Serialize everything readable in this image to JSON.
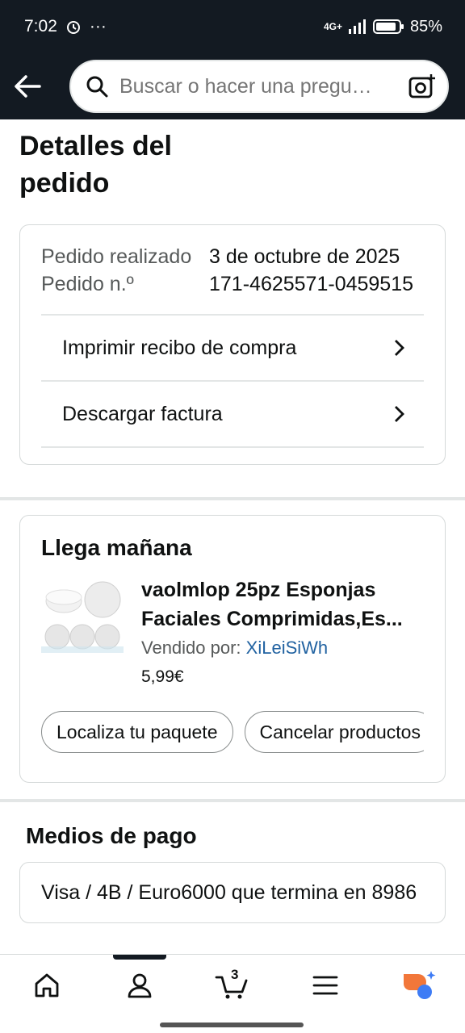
{
  "status": {
    "time": "7:02",
    "network": "4G+",
    "battery": "85%"
  },
  "search": {
    "placeholder": "Buscar o hacer una pregu…"
  },
  "page": {
    "title": "Detalles del pedido"
  },
  "order": {
    "placed_label": "Pedido realizado",
    "placed_value": "3 de octubre de 2025",
    "number_label": "Pedido n.º",
    "number_value": "171-4625571-0459515",
    "links": [
      {
        "label": "Imprimir recibo de compra"
      },
      {
        "label": "Descargar factura"
      }
    ]
  },
  "shipment": {
    "heading": "Llega mañana",
    "product_name": "vaolmlop 25pz Esponjas Faciales Comprimidas,Es...",
    "sold_by_label": "Vendido por:",
    "seller": "XiLeiSiWh",
    "price": "5,99€",
    "buttons": [
      "Localiza tu paquete",
      "Cancelar productos"
    ]
  },
  "payment": {
    "title": "Medios de pago",
    "method": "Visa / 4B / Euro6000 que termina en 8986"
  },
  "nav": {
    "cart_count": "3",
    "active": "account"
  },
  "colors": {
    "header_bg": "#131a22",
    "link": "#2162a1",
    "assistant_orange": "#f2773a",
    "assistant_blue": "#3e7cf5"
  }
}
